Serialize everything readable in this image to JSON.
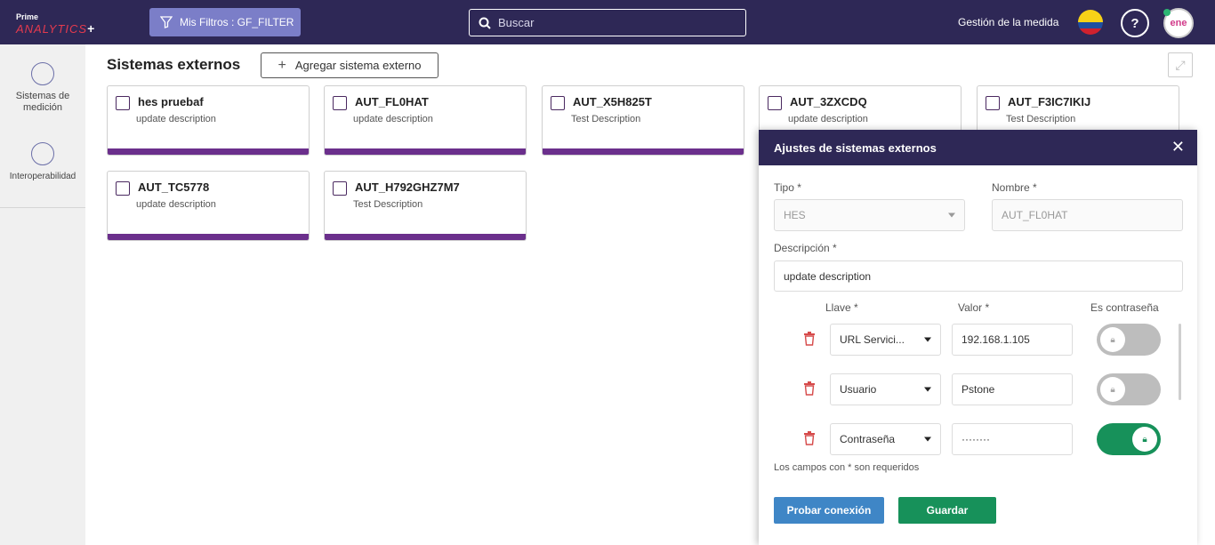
{
  "header": {
    "logo_prime": "Prime",
    "logo_main": "ANALYTICS",
    "logo_plus": "+",
    "filter_label": "Mis Filtros : GF_FILTER",
    "search_placeholder": "Buscar",
    "measure_label": "Gestión de la medida",
    "help_label": "?",
    "avatar_label": "ene"
  },
  "sidebar": {
    "items": [
      {
        "label": "Sistemas de medición",
        "icon": "chart-circle-icon"
      },
      {
        "label": "Interoperabilidad",
        "icon": "network-globe-icon"
      }
    ]
  },
  "main": {
    "title": "Sistemas externos",
    "add_label": "Agregar sistema externo",
    "cards": [
      {
        "name": "hes pruebaf",
        "desc": "update description"
      },
      {
        "name": "AUT_FL0HAT",
        "desc": "update description"
      },
      {
        "name": "AUT_X5H825T",
        "desc": "Test Description"
      },
      {
        "name": "AUT_3ZXCDQ",
        "desc": "update description"
      },
      {
        "name": "AUT_F3IC7IKIJ",
        "desc": "Test Description"
      },
      {
        "name": "AUT_TC5778",
        "desc": "update description"
      },
      {
        "name": "AUT_H792GHZ7M7",
        "desc": "Test Description"
      }
    ]
  },
  "panel": {
    "title": "Ajustes de sistemas externos",
    "tipo_label": "Tipo *",
    "tipo_value": "HES",
    "nombre_label": "Nombre *",
    "nombre_placeholder": "AUT_FL0HAT",
    "desc_label": "Descripción *",
    "desc_value": "update description",
    "llave_label": "Llave *",
    "valor_label": "Valor *",
    "pass_label": "Es contraseña",
    "rows": [
      {
        "key": "URL Servici...",
        "value": "192.168.1.105",
        "is_password": false
      },
      {
        "key": "Usuario",
        "value": "Pstone",
        "is_password": false
      },
      {
        "key": "Contraseña",
        "value": "········",
        "is_password": true
      }
    ],
    "note": "Los campos con * son requeridos",
    "test_label": "Probar conexión",
    "save_label": "Guardar"
  },
  "colors": {
    "header_bg": "#2e2856",
    "card_accent": "#6b2f8c",
    "primary_green": "#17915a",
    "primary_blue": "#3f86c6",
    "filter_btn": "#7b7ec8"
  }
}
